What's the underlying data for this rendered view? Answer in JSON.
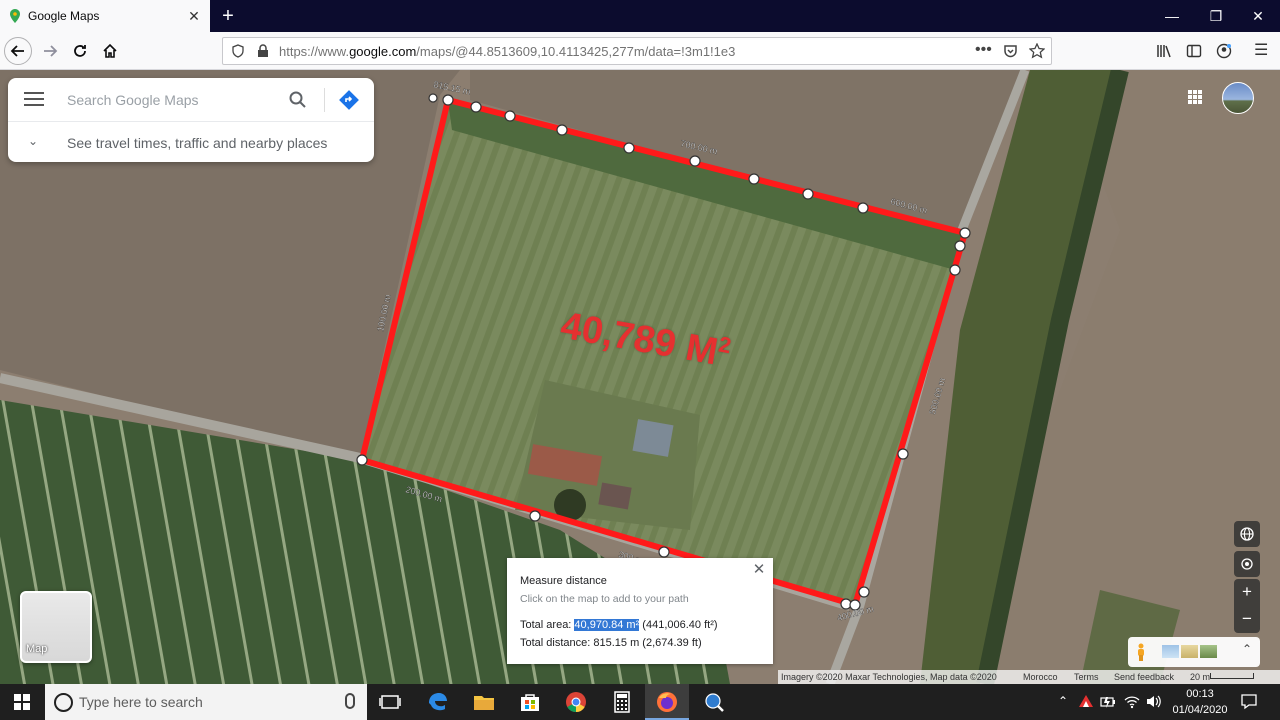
{
  "browser": {
    "tab_title": "Google Maps",
    "url_prefix": "https://www.",
    "url_domain": "google.com",
    "url_path": "/maps/@44.8513609,10.4113425,277m/data=!3m1!1e3"
  },
  "search": {
    "placeholder": "Search Google Maps",
    "hint": "See travel times, traffic and nearby places"
  },
  "map": {
    "area_label": "40,789 M",
    "area_sup": "2",
    "distance_labels": [
      "815.15 m",
      "700.00 m",
      "600.00 m",
      "500.00 m",
      "400.00 m",
      "300 m",
      "200.00 m",
      "100.00 m"
    ],
    "path_color": "#ff1a1a"
  },
  "measure": {
    "title": "Measure distance",
    "hint": "Click on the map to add to your path",
    "area_prefix": "Total area: ",
    "area_value": "40,970.84 m²",
    "area_suffix": " (441,006.40 ft²)",
    "distance": "Total distance: 815.15 m (2,674.39 ft)"
  },
  "layer_tile": {
    "label": "Map"
  },
  "footer": {
    "imagery": "Imagery ©2020 Maxar Technologies, Map data ©2020",
    "country": "Morocco",
    "terms": "Terms",
    "feedback": "Send feedback",
    "scale": "20 m"
  },
  "taskbar": {
    "search_placeholder": "Type here to search",
    "time": "00:13",
    "date": "01/04/2020"
  },
  "colors": {
    "accent": "#e53030",
    "taskbar": "#1f1f1f",
    "selection": "#3378d5"
  }
}
